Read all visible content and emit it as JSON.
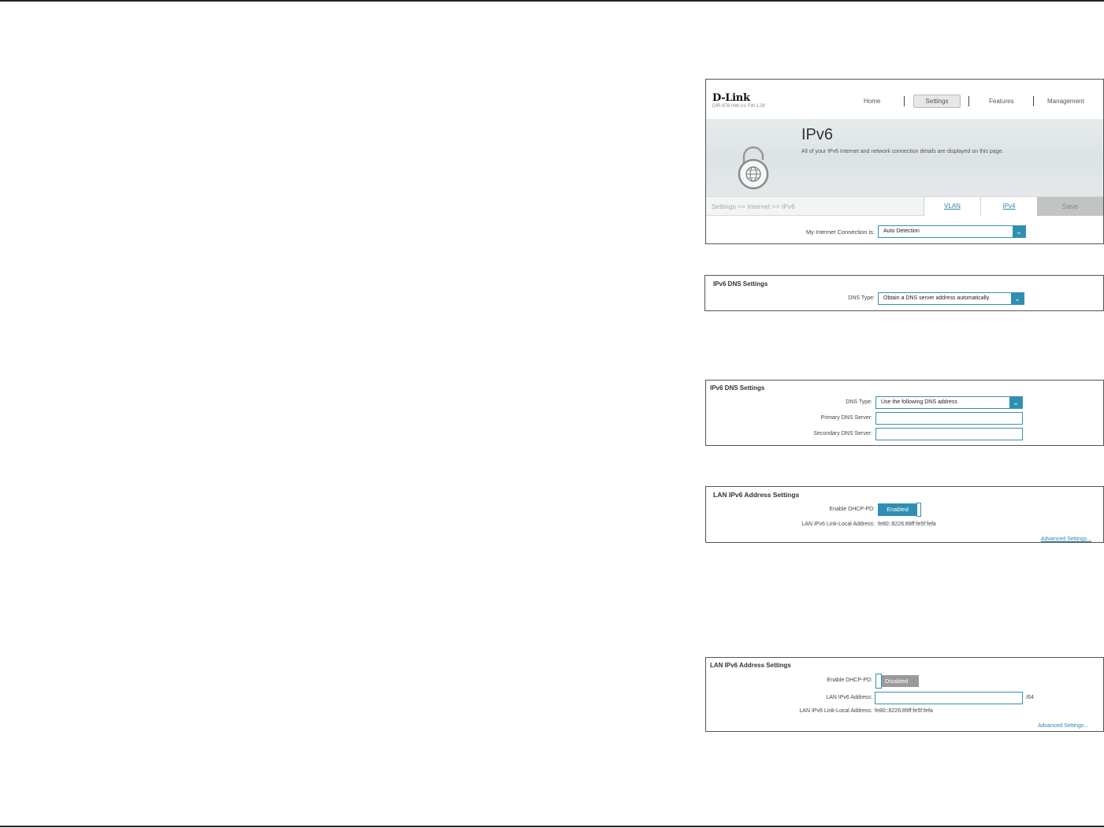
{
  "panel1": {
    "logo": "D-Link",
    "device_info": "DIR-878 HW:A1 FW:1.00",
    "nav": {
      "home": "Home",
      "settings": "Settings",
      "features": "Features",
      "management": "Management"
    },
    "page_title": "IPv6",
    "page_description": "All of your IPv6 Internet and network connection details are displayed on this page.",
    "breadcrumb": "Settings >> Internet >> IPv6",
    "tabs": {
      "vlan": "VLAN",
      "ipv4": "IPv4"
    },
    "save_label": "Save",
    "connection_label": "My Internet Connection is:",
    "connection_value": "Auto Detection",
    "icons": {
      "banner": "lock-globe-icon",
      "dropdown": "chevron-down-icon"
    }
  },
  "panel2": {
    "title": "IPv6 DNS Settings",
    "dns_type_label": "DNS Type:",
    "dns_type_value": "Obtain a DNS server address automatically"
  },
  "panel3": {
    "title": "IPv6 DNS Settings",
    "dns_type_label": "DNS Type:",
    "dns_type_value": "Use the following DNS address",
    "primary_label": "Primary DNS Server:",
    "primary_value": "",
    "secondary_label": "Secondary DNS Server:",
    "secondary_value": ""
  },
  "panel4": {
    "title": "LAN IPv6 Address Settings",
    "dhcp_pd_label": "Enable DHCP-PD:",
    "dhcp_pd_state": "Enabled",
    "link_local_label": "LAN IPv6 Link-Local Address:",
    "link_local_value": "fe80::8226:89ff:fe5f:fefa",
    "advanced_link": "Advanced Settings..."
  },
  "panel5": {
    "title": "LAN IPv6 Address Settings",
    "dhcp_pd_label": "Enable DHCP-PD:",
    "dhcp_pd_state": "Disabled",
    "lan_address_label": "LAN IPv6 Address:",
    "lan_address_value": "",
    "prefix_suffix": "/64",
    "link_local_label": "LAN IPv6 Link-Local Address:",
    "link_local_value": "fe80::8226:89ff:fe5f:fefa",
    "advanced_link": "Advanced Settings..."
  },
  "colors": {
    "accent": "#2f8fb3",
    "disabled_toggle": "#9a9a9a",
    "save_disabled": "#c2c4c4"
  }
}
